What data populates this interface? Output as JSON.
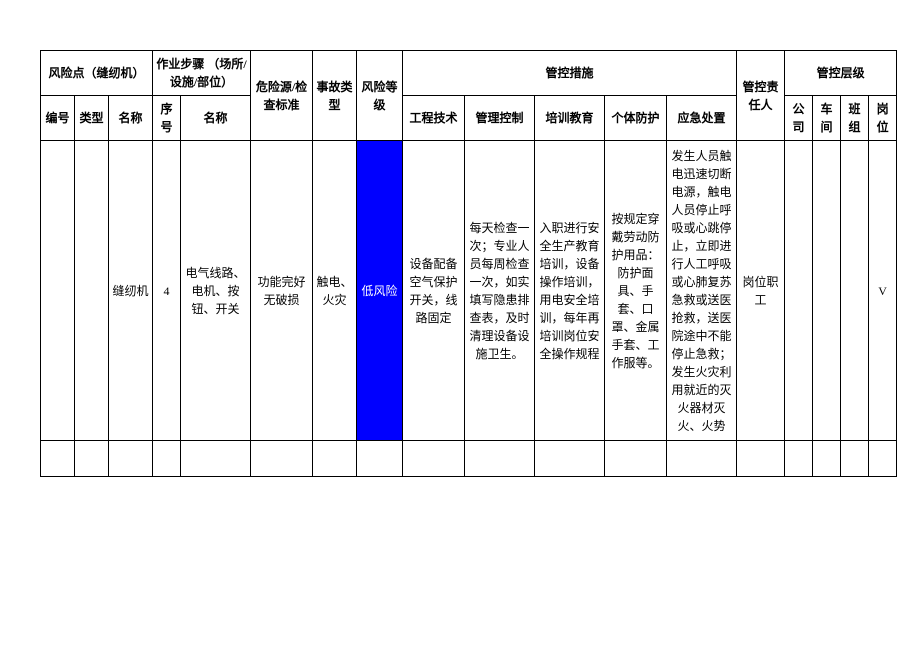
{
  "headers": {
    "risk_point_group": "风险点（缝纫机）",
    "work_step_group": "作业步骤\n（场所/设施/部位）",
    "hazard_standard": "危险源/检查标准",
    "accident_type": "事故类型",
    "risk_level": "风险等级",
    "control_measures_group": "管控措施",
    "responsible_person": "管控责任人",
    "control_level_group": "管控层级",
    "risk_point_no": "编号",
    "risk_point_type": "类型",
    "risk_point_name": "名称",
    "step_seq": "序号",
    "step_name": "名称",
    "measure_engineering": "工程技术",
    "measure_management": "管理控制",
    "measure_training": "培训教育",
    "measure_ppe": "个体防护",
    "measure_emergency": "应急处置",
    "level_company": "公司",
    "level_workshop": "车间",
    "level_team": "班组",
    "level_post": "岗位"
  },
  "row": {
    "risk_point_no": "",
    "risk_point_type": "",
    "risk_point_name": "缝纫机",
    "step_seq": "4",
    "step_name": "电气线路、电机、按钮、开关",
    "hazard_standard": "功能完好无破损",
    "accident_type": "触电、火灾",
    "risk_level": "低风险",
    "engineering": "设备配备空气保护开关，线路固定",
    "management": "每天检查一次；专业人员每周检查一次，如实填写隐患排查表，及时清理设备设施卫生。",
    "training": "入职进行安全生产教育培训，设备操作培训，用电安全培训，每年再培训岗位安全操作规程",
    "ppe": "按规定穿戴劳动防护用品：防护面具、手套、口罩、金属手套、工作服等。",
    "emergency": "发生人员触电迅速切断电源，触电人员停止呼吸或心跳停止，立即进行人工呼吸或心肺复苏急救或送医抢救，送医院途中不能停止急救；发生火灾利用就近的灭火器材灭火、火势",
    "responsible": "岗位职工",
    "lvl_company": "",
    "lvl_workshop": "",
    "lvl_team": "",
    "lvl_post": "V"
  }
}
